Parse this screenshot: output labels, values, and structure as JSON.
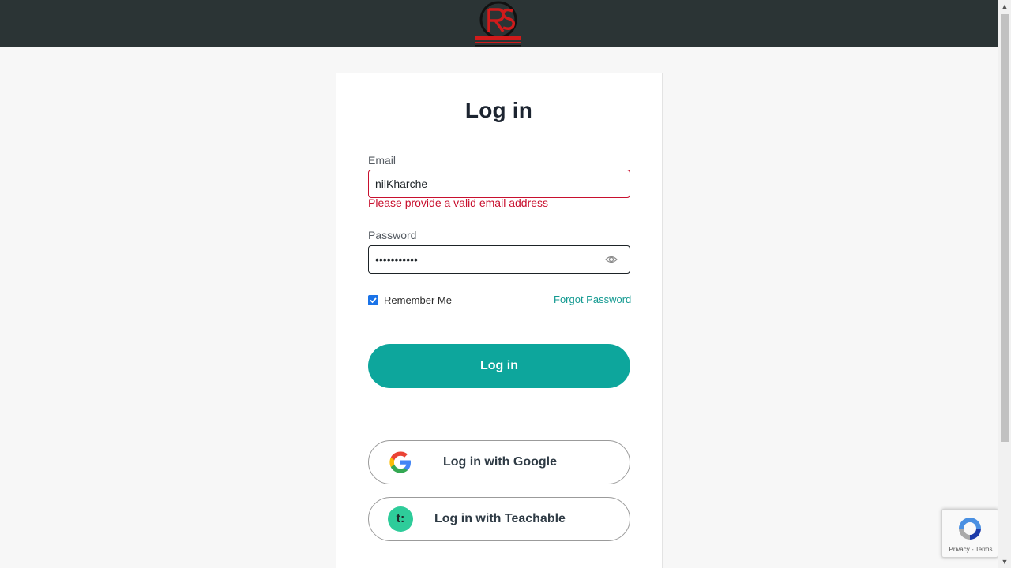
{
  "header": {
    "logo_icon": "rs-academy-logo"
  },
  "login": {
    "title": "Log in",
    "email_label": "Email",
    "email_value": "nilKharche",
    "email_error": "Please provide a valid email address",
    "password_label": "Password",
    "password_value": "•••••••••••",
    "show_password_icon": "eye-icon",
    "remember_me_label": "Remember Me",
    "remember_me_checked": true,
    "forgot_password_label": "Forgot Password",
    "login_button_label": "Log in",
    "google_button_label": "Log in with Google",
    "teachable_button_label": "Log in with Teachable",
    "teachable_icon_text": "t:"
  },
  "recaptcha": {
    "text": "Privacy - Terms"
  },
  "colors": {
    "accent": "#0da69c",
    "error": "#c8102e",
    "header_bg": "#2b3435"
  }
}
